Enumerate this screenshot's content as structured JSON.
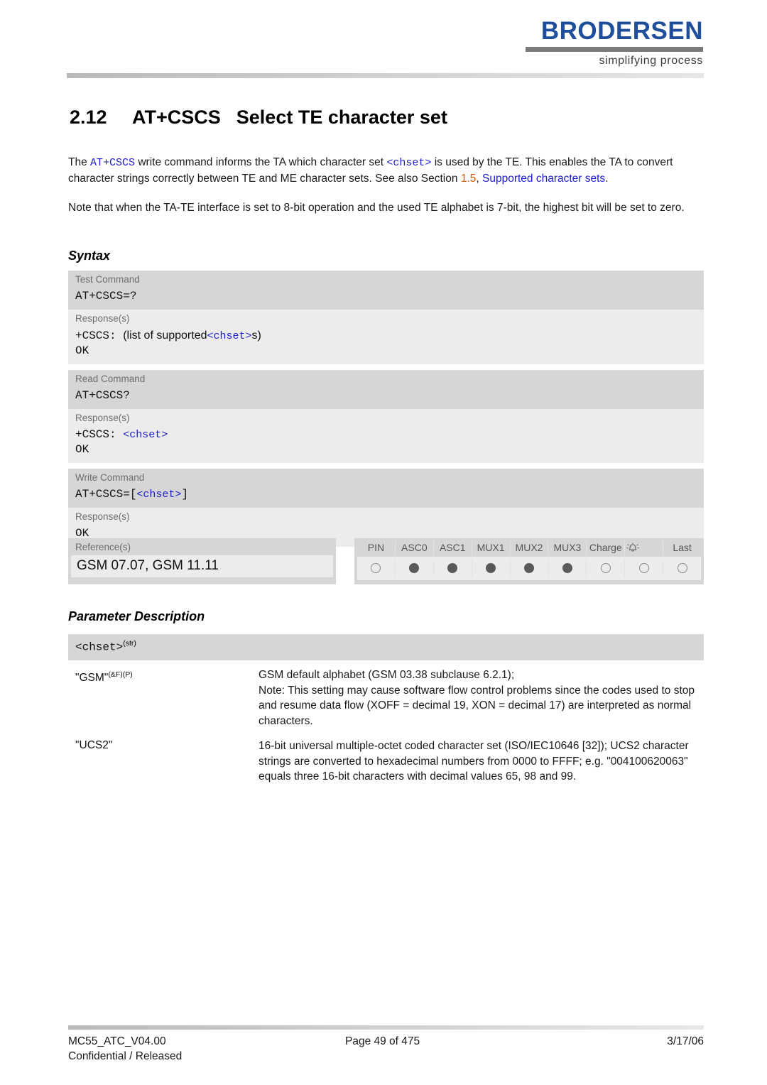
{
  "header": {
    "logo_word": "BRODERSEN",
    "logo_tagline": "simplifying process",
    "brand_color": "#1f4e9c"
  },
  "title": {
    "number": "2.12",
    "command": "AT+CSCS",
    "description": "Select TE character set"
  },
  "intro": {
    "t1": "The ",
    "cmd1": "AT+CSCS",
    "t2": " write command informs the TA which character set ",
    "param1": "<chset>",
    "t3": " is used by the TE. This enables the TA to convert character strings correctly between TE and ME character sets. See also Section ",
    "xref_num": "1.5",
    "t4": ", ",
    "xref_text": "Supported character sets",
    "t5": "."
  },
  "note": {
    "text": "Note that when the TA-TE interface is set to 8-bit operation and the used TE alphabet is 7-bit, the highest bit will be set to zero."
  },
  "headings": {
    "syntax": "Syntax",
    "parameter_description": "Parameter Description"
  },
  "syntax": {
    "groups": [
      {
        "cmd_label": "Test Command",
        "cmd_value": "AT+CSCS=?",
        "resp_label": "Response(s)",
        "resp_prefix": "+CSCS:",
        "resp_mid": "(list of supported",
        "resp_param": "<chset>",
        "resp_suffix": "s)",
        "resp_ok": "OK"
      },
      {
        "cmd_label": "Read Command",
        "cmd_value": "AT+CSCS?",
        "resp_label": "Response(s)",
        "resp_prefix": "+CSCS:",
        "resp_param": "<chset>",
        "resp_ok": "OK"
      },
      {
        "cmd_label": "Write Command",
        "cmd_value_prefix": "AT+CSCS=[",
        "cmd_value_param": "<chset>",
        "cmd_value_suffix": "]",
        "resp_label": "Response(s)",
        "resp_ok": "OK"
      }
    ]
  },
  "references": {
    "label": "Reference(s)",
    "value": "GSM 07.07, GSM 11.11"
  },
  "indicators": {
    "columns": [
      "PIN",
      "ASC0",
      "ASC1",
      "MUX1",
      "MUX2",
      "MUX3",
      "Charge",
      "alarm-bell-icon",
      "Last"
    ],
    "states": [
      "empty",
      "filled",
      "filled",
      "filled",
      "filled",
      "filled",
      "empty",
      "empty",
      "empty"
    ],
    "filled_color": "#595959",
    "empty_border_color": "#8a8a8a"
  },
  "parameters": {
    "key_head": "<chset>",
    "key_head_sup": "(str)",
    "rows": [
      {
        "key": "\"GSM\"",
        "key_sup": "(&F)(P)",
        "desc_lines": [
          "GSM default alphabet (GSM 03.38 subclause 6.2.1);",
          "Note: This setting may cause software flow control problems since the codes used to stop and resume data flow (XOFF = decimal 19, XON = decimal 17) are interpreted as normal characters."
        ]
      },
      {
        "key": "\"UCS2\"",
        "key_sup": "",
        "desc_lines": [
          "16-bit universal multiple-octet coded character set (ISO/IEC10646 [32]); UCS2 character strings are converted to hexadecimal numbers from 0000 to FFFF; e.g. \"004100620063\" equals three 16-bit characters with decimal values 65, 98 and 99."
        ]
      }
    ]
  },
  "footer": {
    "doc_id": "MC55_ATC_V04.00",
    "classification": "Confidential / Released",
    "page": "Page 49 of 475",
    "date": "3/17/06"
  }
}
